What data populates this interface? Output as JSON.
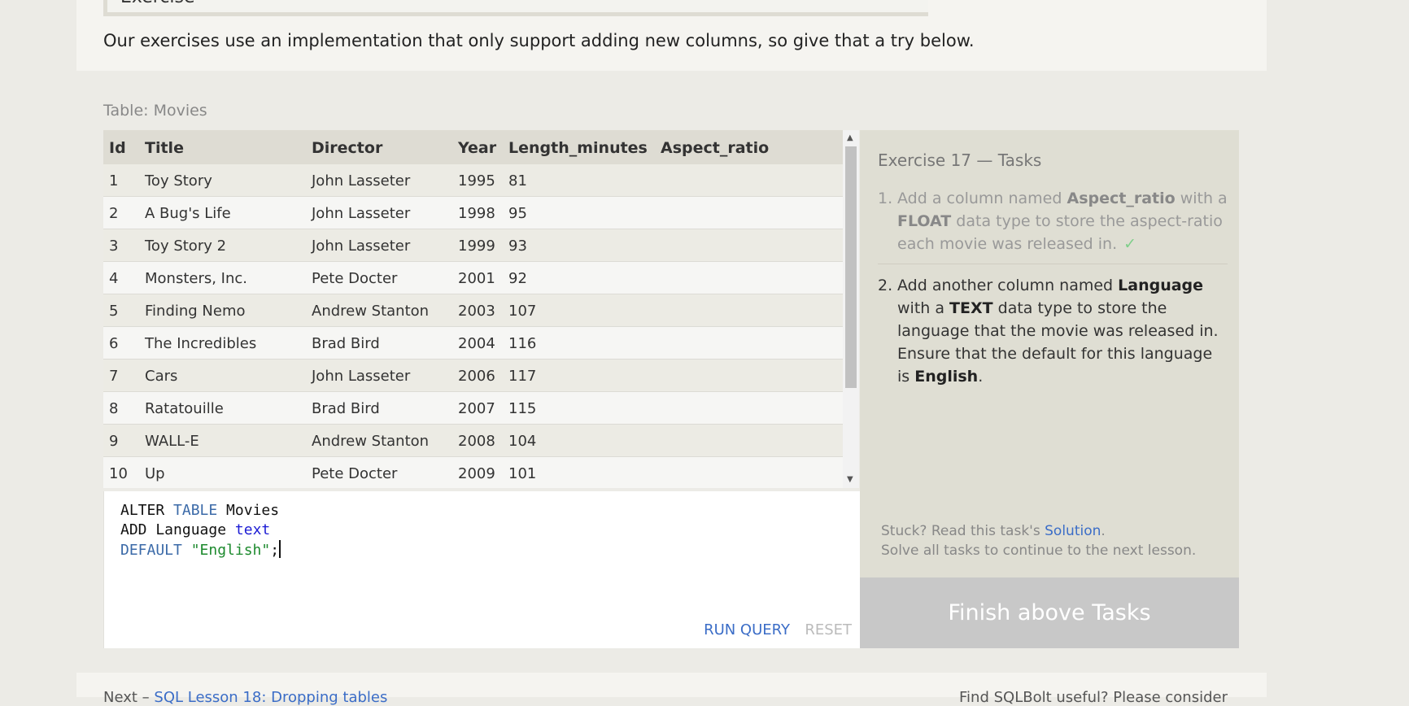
{
  "exercise": {
    "heading": "Exercise",
    "intro": "Our exercises use an implementation that only support adding new columns, so give that a try below."
  },
  "table": {
    "label": "Table: Movies",
    "columns": [
      "Id",
      "Title",
      "Director",
      "Year",
      "Length_minutes",
      "Aspect_ratio"
    ],
    "rows": [
      [
        "1",
        "Toy Story",
        "John Lasseter",
        "1995",
        "81",
        ""
      ],
      [
        "2",
        "A Bug's Life",
        "John Lasseter",
        "1998",
        "95",
        ""
      ],
      [
        "3",
        "Toy Story 2",
        "John Lasseter",
        "1999",
        "93",
        ""
      ],
      [
        "4",
        "Monsters, Inc.",
        "Pete Docter",
        "2001",
        "92",
        ""
      ],
      [
        "5",
        "Finding Nemo",
        "Andrew Stanton",
        "2003",
        "107",
        ""
      ],
      [
        "6",
        "The Incredibles",
        "Brad Bird",
        "2004",
        "116",
        ""
      ],
      [
        "7",
        "Cars",
        "John Lasseter",
        "2006",
        "117",
        ""
      ],
      [
        "8",
        "Ratatouille",
        "Brad Bird",
        "2007",
        "115",
        ""
      ],
      [
        "9",
        "WALL-E",
        "Andrew Stanton",
        "2008",
        "104",
        ""
      ],
      [
        "10",
        "Up",
        "Pete Docter",
        "2009",
        "101",
        ""
      ]
    ]
  },
  "editor": {
    "code": {
      "l1a": "ALTER ",
      "l1b": "TABLE",
      "l1c": " Movies",
      "l2a": "ADD Language ",
      "l2b": "text",
      "l3a": "DEFAULT",
      "l3b": " ",
      "l3c": "\"English\"",
      "l3d": ";"
    },
    "run_label": "RUN QUERY",
    "reset_label": "RESET"
  },
  "tasks": {
    "title": "Exercise 17 — Tasks",
    "task1": {
      "num": "1.",
      "t1": "Add a column named ",
      "b1": "Aspect_ratio",
      "t2": " with a ",
      "b2": "FLOAT",
      "t3": " data type to store the aspect-ratio each movie was released in.",
      "check": "✓"
    },
    "task2": {
      "num": "2.",
      "t1": "Add another column named ",
      "b1": "Language",
      "t2": " with a ",
      "b2": "TEXT",
      "t3": " data type to store the language that the movie was released in. Ensure that the default for this language is ",
      "b3": "English",
      "t4": "."
    },
    "stuck_prefix": "Stuck? Read this task's ",
    "solution_link": "Solution",
    "stuck_suffix": ".",
    "solve_text": "Solve all tasks to continue to the next lesson.",
    "finish_label": "Finish above Tasks"
  },
  "footer": {
    "next_prefix": "Next – ",
    "next_link": "SQL Lesson 18: Dropping tables",
    "right_text": "Find SQLBolt useful? Please consider"
  },
  "colors": {
    "accent_link": "#3b6dc7",
    "check": "#7fcf8a",
    "finish_bg": "#c8c8c8"
  }
}
